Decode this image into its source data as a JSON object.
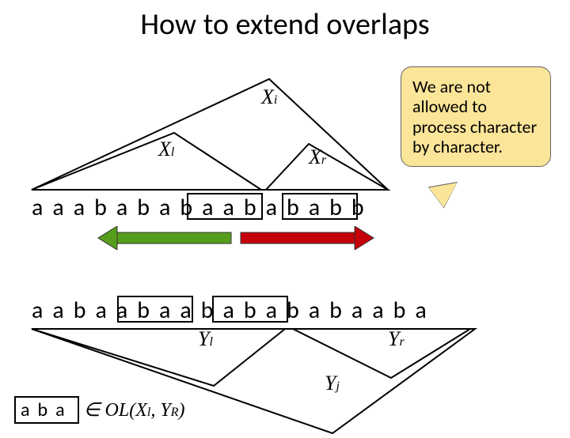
{
  "title": "How to extend overlaps",
  "callout": "We are not allowed to process character by character.",
  "row1": "aaabababaabababb",
  "row2": "aabaabaababababaaba",
  "labels": {
    "Xi": "X",
    "Xi_sub": "i",
    "Xl": "X",
    "Xl_sub": "l",
    "Xr": "X",
    "Xr_sub": "r",
    "Yl": "Y",
    "Yl_sub": "l",
    "Yr": "Y",
    "Yr_sub": "r",
    "Yj": "Y",
    "Yj_sub": "j"
  },
  "membership": {
    "box": "aba",
    "text": " ∈ OL(X",
    "sub1": "l",
    "text2": ", Y",
    "sub2": "R",
    "text3": ")"
  }
}
